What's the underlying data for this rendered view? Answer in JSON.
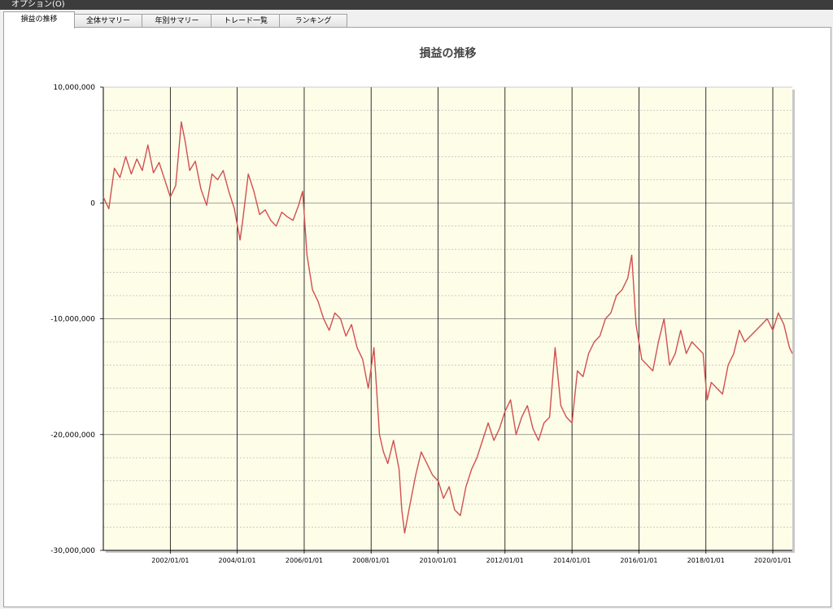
{
  "menu": {
    "options_label": "オプション(O)"
  },
  "tabs": [
    {
      "label": "損益の推移",
      "active": true
    },
    {
      "label": "全体サマリー",
      "active": false
    },
    {
      "label": "年別サマリー",
      "active": false
    },
    {
      "label": "トレード一覧",
      "active": false
    },
    {
      "label": "ランキング",
      "active": false
    }
  ],
  "colors": {
    "plot_background": "#fefde8",
    "line": "#d05050",
    "gridline": "#808080"
  },
  "chart_data": {
    "type": "line",
    "title": "損益の推移",
    "xlabel": "",
    "ylabel": "",
    "ylim": [
      -30000000,
      10000000
    ],
    "xlim": [
      "2000-01-01",
      "2020-08-01"
    ],
    "yticks": [
      "10,000,000",
      "0",
      "-10,000,000",
      "-20,000,000",
      "-30,000,000"
    ],
    "xticks": [
      "2002/01/01",
      "2004/01/01",
      "2006/01/01",
      "2008/01/01",
      "2010/01/01",
      "2012/01/01",
      "2014/01/01",
      "2016/01/01",
      "2018/01/01",
      "2020/01/01"
    ],
    "grid": true,
    "legend": "none",
    "series": [
      {
        "x": [
          "2000-01-01",
          "2000-03-01",
          "2000-05-01",
          "2000-07-01",
          "2000-09-01",
          "2000-11-01",
          "2001-01-01",
          "2001-03-01",
          "2001-05-01",
          "2001-07-01",
          "2001-09-01",
          "2001-11-01",
          "2002-01-01",
          "2002-03-01",
          "2002-05-01",
          "2002-06-15",
          "2002-08-01",
          "2002-10-01",
          "2002-12-01",
          "2003-02-01",
          "2003-04-01",
          "2003-06-01",
          "2003-08-01",
          "2003-10-01",
          "2003-12-01",
          "2004-02-01",
          "2004-03-01",
          "2004-05-01",
          "2004-07-01",
          "2004-09-01",
          "2004-11-01",
          "2005-01-01",
          "2005-03-01",
          "2005-05-01",
          "2005-07-01",
          "2005-09-01",
          "2005-11-01",
          "2005-12-15",
          "2006-01-01",
          "2006-02-01",
          "2006-04-01",
          "2006-06-01",
          "2006-08-01",
          "2006-10-01",
          "2006-12-01",
          "2007-02-01",
          "2007-04-01",
          "2007-06-01",
          "2007-08-01",
          "2007-10-01",
          "2007-12-01",
          "2008-02-01",
          "2008-04-01",
          "2008-05-15",
          "2008-07-01",
          "2008-09-01",
          "2008-11-01",
          "2008-12-01",
          "2009-01-01",
          "2009-03-01",
          "2009-05-01",
          "2009-07-01",
          "2009-09-01",
          "2009-11-01",
          "2010-01-01",
          "2010-03-01",
          "2010-05-01",
          "2010-07-01",
          "2010-09-01",
          "2010-11-01",
          "2011-01-01",
          "2011-03-01",
          "2011-05-01",
          "2011-07-01",
          "2011-09-01",
          "2011-11-01",
          "2012-01-01",
          "2012-03-01",
          "2012-05-01",
          "2012-07-01",
          "2012-09-01",
          "2012-11-01",
          "2013-01-01",
          "2013-03-01",
          "2013-05-01",
          "2013-07-01",
          "2013-09-01",
          "2013-11-01",
          "2014-01-01",
          "2014-03-01",
          "2014-05-01",
          "2014-07-01",
          "2014-09-01",
          "2014-11-01",
          "2015-01-01",
          "2015-03-01",
          "2015-05-01",
          "2015-07-01",
          "2015-09-01",
          "2015-10-15",
          "2015-12-01",
          "2016-02-01",
          "2016-04-01",
          "2016-06-01",
          "2016-08-01",
          "2016-10-01",
          "2016-12-01",
          "2017-02-01",
          "2017-04-01",
          "2017-06-01",
          "2017-08-01",
          "2017-10-01",
          "2017-12-01",
          "2018-01-15",
          "2018-03-01",
          "2018-05-01",
          "2018-07-01",
          "2018-09-01",
          "2018-11-01",
          "2019-01-01",
          "2019-03-01",
          "2019-05-01",
          "2019-07-01",
          "2019-09-01",
          "2019-11-01",
          "2020-01-01",
          "2020-03-01",
          "2020-05-01",
          "2020-07-01",
          "2020-08-01"
        ],
        "y": [
          500000,
          -500000,
          3000000,
          2200000,
          4000000,
          2500000,
          3800000,
          2800000,
          5000000,
          2600000,
          3500000,
          2000000,
          500000,
          1500000,
          7000000,
          5200000,
          2800000,
          3600000,
          1200000,
          -200000,
          2500000,
          2000000,
          2800000,
          1000000,
          -500000,
          -3200000,
          -1500000,
          2500000,
          1000000,
          -1000000,
          -600000,
          -1500000,
          -2000000,
          -800000,
          -1200000,
          -1500000,
          -200000,
          1000000,
          -1000000,
          -4500000,
          -7500000,
          -8500000,
          -10000000,
          -11000000,
          -9500000,
          -10000000,
          -11500000,
          -10500000,
          -12500000,
          -13500000,
          -16000000,
          -12500000,
          -20000000,
          -21500000,
          -22500000,
          -20500000,
          -23000000,
          -26500000,
          -28500000,
          -26000000,
          -23500000,
          -21500000,
          -22500000,
          -23500000,
          -24000000,
          -25500000,
          -24500000,
          -26500000,
          -27000000,
          -24500000,
          -23000000,
          -22000000,
          -20500000,
          -19000000,
          -20500000,
          -19500000,
          -18000000,
          -17000000,
          -20000000,
          -18500000,
          -17500000,
          -19500000,
          -20500000,
          -19000000,
          -18500000,
          -12500000,
          -17500000,
          -18500000,
          -19000000,
          -14500000,
          -15000000,
          -13000000,
          -12000000,
          -11500000,
          -10000000,
          -9500000,
          -8000000,
          -7500000,
          -6500000,
          -4500000,
          -10500000,
          -13500000,
          -14000000,
          -14500000,
          -12000000,
          -10000000,
          -14000000,
          -13000000,
          -11000000,
          -13000000,
          -12000000,
          -12500000,
          -13000000,
          -17000000,
          -15500000,
          -16000000,
          -16500000,
          -14000000,
          -13000000,
          -11000000,
          -12000000,
          -11500000,
          -11000000,
          -10500000,
          -10000000,
          -11000000,
          -9500000,
          -10500000,
          -12500000,
          -13000000
        ]
      }
    ]
  }
}
